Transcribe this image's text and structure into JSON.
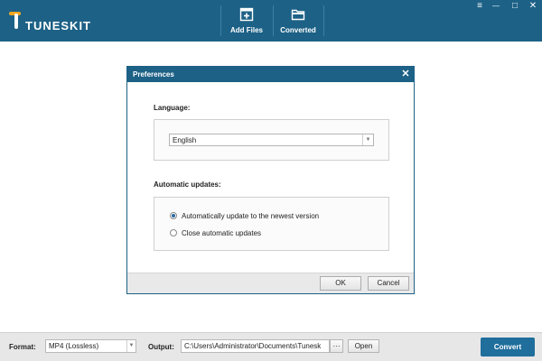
{
  "app": {
    "brand": "TUNESKIT",
    "colors": {
      "titlebar": "#1d6186",
      "accent": "#1f6e9c"
    }
  },
  "toolbar": {
    "add_files": {
      "label": "Add Files",
      "icon": "add-file-icon"
    },
    "converted": {
      "label": "Converted",
      "icon": "folder-icon"
    }
  },
  "window_controls": {
    "menu": "≡",
    "minimize": "—",
    "maximize": "□",
    "close": "✕"
  },
  "dialog": {
    "title": "Preferences",
    "close": "✕",
    "language": {
      "label": "Language:",
      "selected": "English"
    },
    "updates": {
      "label": "Automatic updates:",
      "options": [
        {
          "label": "Automatically update to the newest version",
          "checked": true
        },
        {
          "label": "Close automatic updates",
          "checked": false
        }
      ]
    },
    "ok_label": "OK",
    "cancel_label": "Cancel"
  },
  "bottombar": {
    "format_label": "Format:",
    "format_value": "MP4 (Lossless)",
    "output_label": "Output:",
    "output_value": "C:\\Users\\Administrator\\Documents\\Tunesk",
    "browse_label": "···",
    "open_label": "Open",
    "convert_label": "Convert"
  }
}
